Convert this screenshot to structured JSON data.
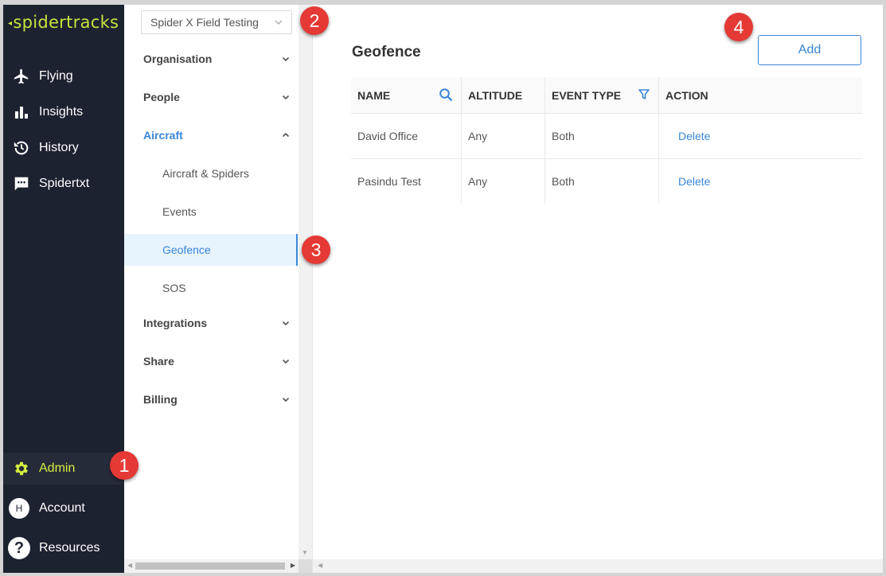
{
  "nav": {
    "logo": "spidertracks",
    "items": [
      {
        "label": "Flying",
        "icon": "airplane-icon"
      },
      {
        "label": "Insights",
        "icon": "bar-chart-icon"
      },
      {
        "label": "History",
        "icon": "history-icon"
      },
      {
        "label": "Spidertxt",
        "icon": "chat-icon"
      }
    ],
    "bottom": [
      {
        "label": "Admin",
        "icon": "gear-icon"
      },
      {
        "label": "Account",
        "avatar": "H"
      },
      {
        "label": "Resources",
        "icon": "help-icon"
      }
    ]
  },
  "org_select": {
    "value": "Spider X Field Testing"
  },
  "submenu": {
    "organisation": "Organisation",
    "people": "People",
    "aircraft": "Aircraft",
    "aircraft_items": [
      "Aircraft & Spiders",
      "Events",
      "Geofence",
      "SOS"
    ],
    "integrations": "Integrations",
    "share": "Share",
    "billing": "Billing"
  },
  "main": {
    "title": "Geofence",
    "add_label": "Add",
    "columns": [
      "NAME",
      "ALTITUDE",
      "EVENT TYPE",
      "ACTION"
    ],
    "rows": [
      {
        "name": "David Office",
        "altitude": "Any",
        "event_type": "Both",
        "action": "Delete"
      },
      {
        "name": "Pasindu Test",
        "altitude": "Any",
        "event_type": "Both",
        "action": "Delete"
      }
    ]
  },
  "callouts": [
    "1",
    "2",
    "3",
    "4"
  ],
  "colors": {
    "accent": "#3a86d8",
    "nav_bg": "#1d2231",
    "active_nav": "#d6ee40",
    "callout": "#e53935"
  }
}
